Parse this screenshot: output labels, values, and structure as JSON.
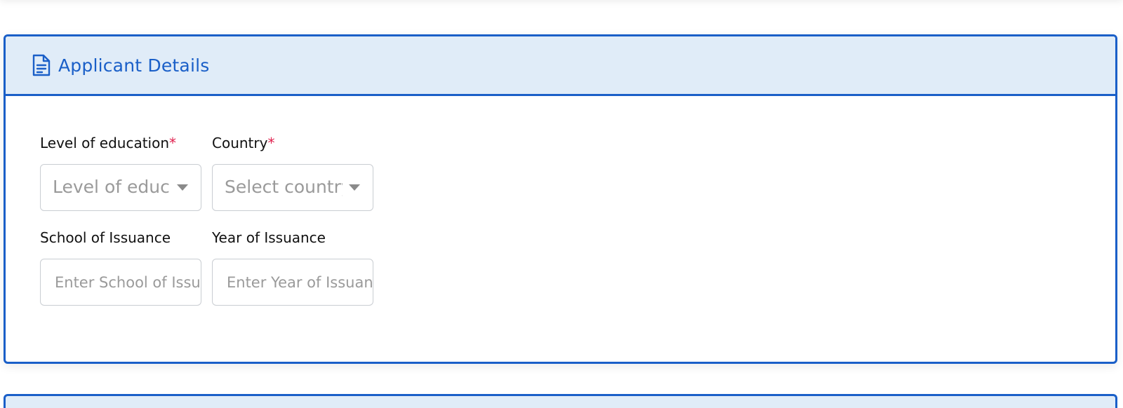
{
  "card": {
    "title": "Applicant Details",
    "header_icon": "document-icon"
  },
  "fields": {
    "education": {
      "label": "Level of education",
      "required_mark": "*",
      "placeholder": "Level of educa"
    },
    "country": {
      "label": "Country",
      "required_mark": "*",
      "placeholder": "Select country"
    },
    "school": {
      "label": "School of Issuance",
      "placeholder": "Enter School of Issuance"
    },
    "year": {
      "label": "Year of Issuance",
      "placeholder": "Enter Year of Issuance"
    }
  },
  "colors": {
    "accent": "#1a5fc8",
    "header_bg": "#e0ecf8",
    "required": "#e0224f",
    "placeholder": "#9a9a9a"
  }
}
